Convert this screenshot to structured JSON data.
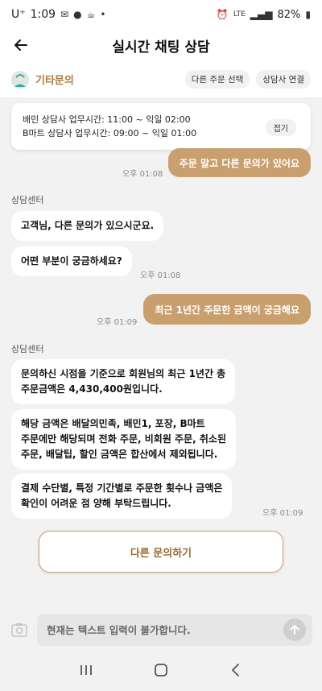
{
  "status_bar": {
    "carrier": "U⁺",
    "time": "1:09",
    "network": "LTE",
    "battery": "82%"
  },
  "header": {
    "title": "실시간 채팅 상담"
  },
  "subheader": {
    "category": "기타문의",
    "action1": "다른 주문 선택",
    "action2": "상담사 연결"
  },
  "hours_card": {
    "line1": "배민 상담사 업무시간: 11:00 ~ 익일 02:00",
    "line2": "B마트 상담사 업무시간: 09:00 ~ 익일 01:00",
    "fold": "접기"
  },
  "messages": {
    "user1": "주문 말고 다른 문의가 있어요",
    "user1_time": "오후 01:08",
    "sender1": "상담센터",
    "bot1": "고객님, 다른 문의가 있으시군요.",
    "bot2": "어떤 부분이 궁금하세요?",
    "bot2_time": "오후 01:08",
    "user2": "최근 1년간 주문한 금액이 궁금해요",
    "user2_time": "오후 01:09",
    "sender2": "상담센터",
    "bot3_l1": "문의하신 시점을 기준으로 회원님의 최근 1년간 총",
    "bot3_l2": "주문금액은 4,430,400원입니다.",
    "bot4_l1": "해당 금액은 배달의민족, 배민1, 포장, B마트",
    "bot4_l2": "주문에만 해당되며 전화 주문, 비회원 주문, 취소된",
    "bot4_l3": "주문, 배달팁, 할인 금액은 합산에서 제외됩니다.",
    "bot5_l1": "결제 수단별, 특정 기간별로 주문한 횟수나 금액은",
    "bot5_l2": "확인이 어려운 점 양해 부탁드립니다.",
    "bot5_time": "오후 01:09"
  },
  "other_inquiry_button": "다른 문의하기",
  "input": {
    "placeholder": "현재는 텍스트 입력이 불가합니다."
  },
  "colors": {
    "accent": "#c99f6e",
    "accent_text": "#b07a3e"
  }
}
